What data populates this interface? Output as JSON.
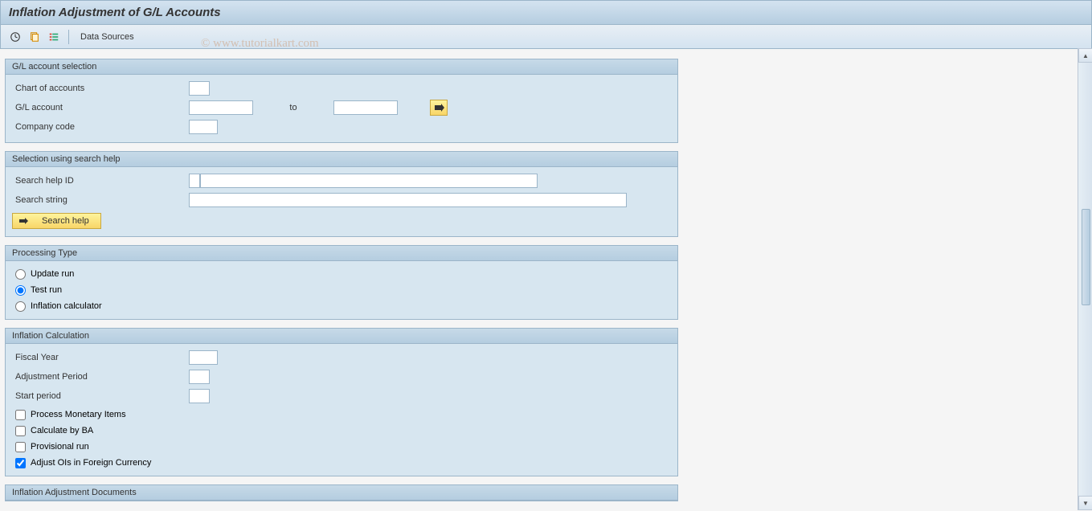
{
  "title": "Inflation Adjustment of G/L Accounts",
  "toolbar": {
    "data_sources": "Data Sources"
  },
  "watermark": "© www.tutorialkart.com",
  "group1": {
    "title": "G/L account selection",
    "chart_of_accounts": "Chart of accounts",
    "gl_account": "G/L account",
    "to": "to",
    "company_code": "Company code"
  },
  "group2": {
    "title": "Selection using search help",
    "search_help_id": "Search help ID",
    "search_string": "Search string",
    "search_help_btn": "Search help"
  },
  "group3": {
    "title": "Processing Type",
    "update_run": "Update run",
    "test_run": "Test run",
    "inflation_calculator": "Inflation calculator"
  },
  "group4": {
    "title": "Inflation Calculation",
    "fiscal_year": "Fiscal Year",
    "adjustment_period": "Adjustment Period",
    "start_period": "Start period",
    "process_monetary": "Process Monetary Items",
    "calculate_ba": "Calculate by BA",
    "provisional_run": "Provisional run",
    "adjust_ois": "Adjust OIs in Foreign Currency"
  },
  "group5": {
    "title": "Inflation Adjustment Documents"
  }
}
